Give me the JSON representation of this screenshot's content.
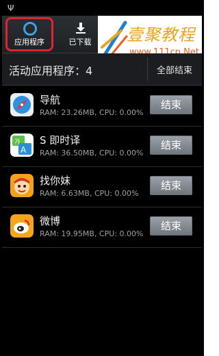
{
  "tabs": [
    {
      "label": "应用程序",
      "icon": "ring-icon"
    },
    {
      "label": "已下载",
      "icon": "download-icon"
    }
  ],
  "watermark": {
    "title": "壹聚教程",
    "url": "www.111cn.Net"
  },
  "header": {
    "active_count": "活动应用程序：4",
    "end_all_label": "全部结束"
  },
  "apps": [
    {
      "name": "导航",
      "stats": "RAM: 23.26MB, CPU: 0.00%",
      "button": "结束",
      "icon": "compass-icon"
    },
    {
      "name": "S 即时译",
      "stats": "RAM: 36.50MB, CPU: 0.00%",
      "button": "结束",
      "icon": "translate-icon"
    },
    {
      "name": "找你妹",
      "stats": "RAM: 6.63MB, CPU: 0.00%",
      "button": "结束",
      "icon": "game-icon"
    },
    {
      "name": "微博",
      "stats": "RAM: 19.95MB, CPU: 0.00%",
      "button": "结束",
      "icon": "weibo-icon"
    }
  ],
  "colors": {
    "highlight": "#e0252b",
    "accent": "#3aa3ea",
    "watermark": "#e8a41f"
  }
}
